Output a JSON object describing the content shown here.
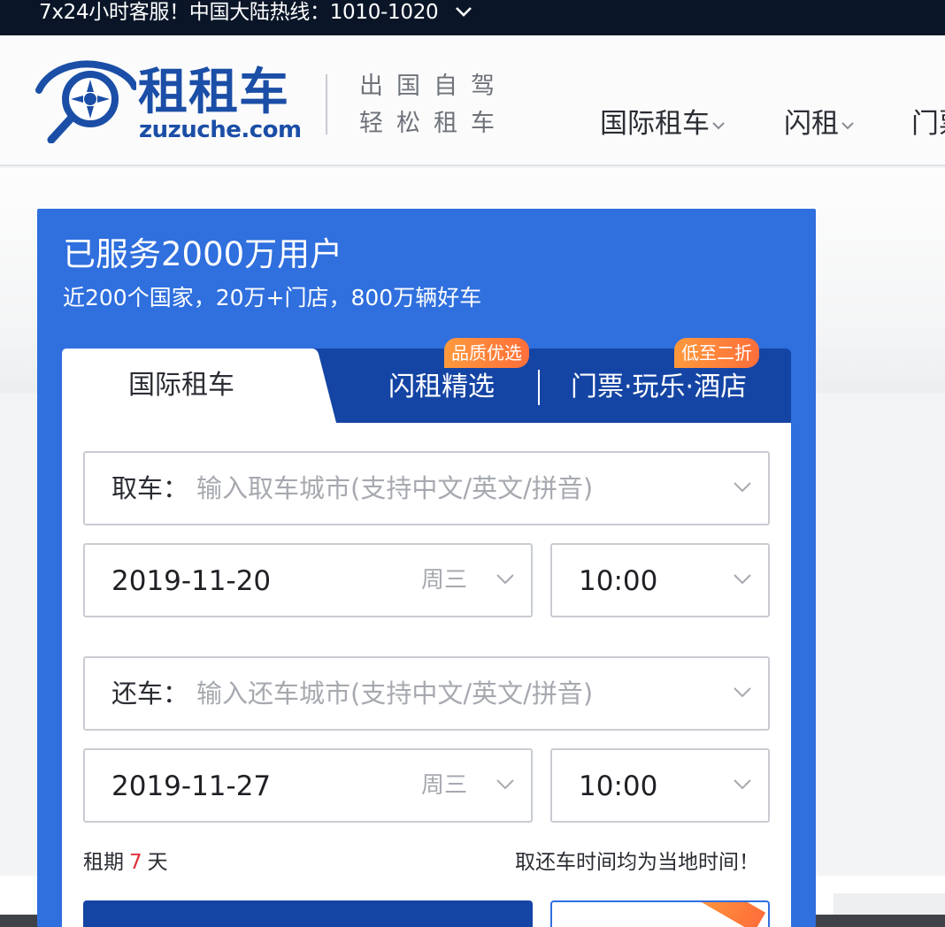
{
  "topbar": {
    "hotline": "7x24小时客服！中国大陆热线：1010-1020"
  },
  "logo": {
    "name": "租租车",
    "domain": "zuzuche.com"
  },
  "slogan": {
    "line1": "出国自驾",
    "line2": "轻松租车"
  },
  "nav": {
    "intl": "国际租车",
    "flash": "闪租",
    "ticket": "门票"
  },
  "panel": {
    "title": "已服务2000万用户",
    "subtitle": "近200个国家，20万+门店，800万辆好车"
  },
  "tabs": {
    "intl": "国际租车",
    "flash": "闪租精选",
    "ticket": "门票·玩乐·酒店",
    "badge_flash": "品质优选",
    "badge_ticket": "低至二折"
  },
  "pickup": {
    "label": "取车：",
    "placeholder": "输入取车城市(支持中文/英文/拼音)",
    "date": "2019-11-20",
    "weekday": "周三",
    "time": "10:00"
  },
  "return": {
    "label": "还车：",
    "placeholder": "输入还车城市(支持中文/英文/拼音)",
    "date": "2019-11-27",
    "weekday": "周三",
    "time": "10:00"
  },
  "rental": {
    "prefix": "租期",
    "days": "7",
    "suffix": "天",
    "note": "取还车时间均为当地时间！"
  },
  "colors": {
    "panel_blue": "#2f6fde",
    "tab_dark_blue": "#1545a4",
    "brand_blue": "#1b4ea6",
    "badge_orange": "#ff7b3a",
    "days_red": "#e0303a",
    "topbar_bg": "#0a1628"
  }
}
